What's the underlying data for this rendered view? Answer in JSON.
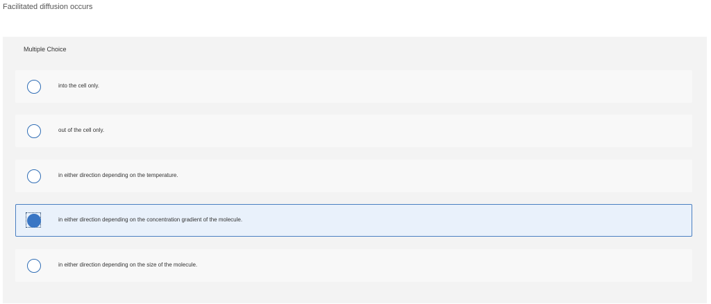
{
  "question": {
    "text": "Facilitated diffusion occurs"
  },
  "panel": {
    "header": "Multiple Choice",
    "selected_index": 3,
    "options": [
      {
        "label": "into the cell only."
      },
      {
        "label": "out of the cell only."
      },
      {
        "label": "in either direction depending on the temperature."
      },
      {
        "label": "in either direction depending on the concentration gradient of the molecule."
      },
      {
        "label": "in either direction depending on the size of the molecule."
      }
    ]
  },
  "colors": {
    "accent": "#3a76c4",
    "selected_bg": "#e9f1fb",
    "panel_bg": "#f3f3f3"
  }
}
